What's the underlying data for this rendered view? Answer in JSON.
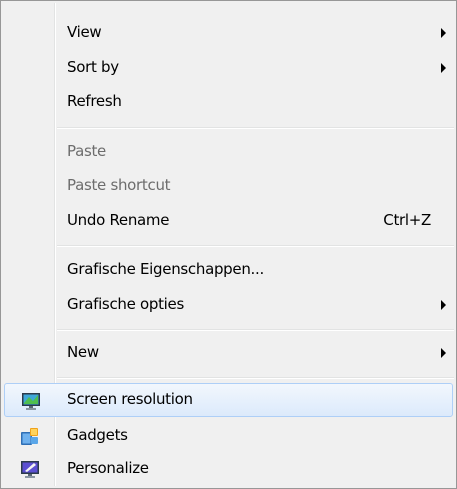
{
  "menu": {
    "items": [
      {
        "label": "View",
        "has_submenu": true
      },
      {
        "label": "Sort by",
        "has_submenu": true
      },
      {
        "label": "Refresh"
      },
      {
        "label": "Paste",
        "disabled": true
      },
      {
        "label": "Paste shortcut",
        "disabled": true
      },
      {
        "label": "Undo Rename",
        "shortcut": "Ctrl+Z"
      },
      {
        "label": "Grafische Eigenschappen..."
      },
      {
        "label": "Grafische opties",
        "has_submenu": true
      },
      {
        "label": "New",
        "has_submenu": true
      },
      {
        "label": "Screen resolution",
        "icon": "monitor-icon",
        "highlighted": true
      },
      {
        "label": "Gadgets",
        "icon": "gadgets-icon"
      },
      {
        "label": "Personalize",
        "icon": "personalize-icon"
      }
    ]
  },
  "colors": {
    "menu_bg": "#f0f0f0",
    "disabled_text": "#6d6d6d",
    "highlight_border": "#aecff7"
  }
}
